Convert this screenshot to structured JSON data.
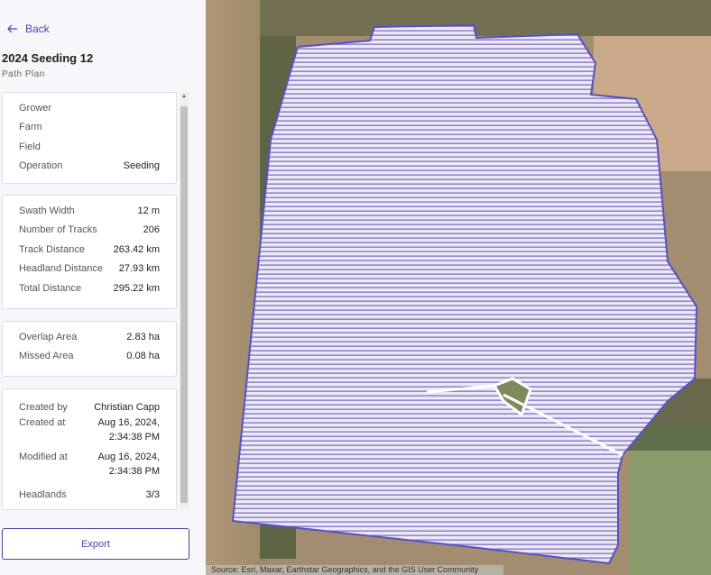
{
  "nav": {
    "back_label": "Back",
    "back_icon": "arrow-left-icon"
  },
  "header": {
    "title": "2024 Seeding 12",
    "subtitle": "Path Plan"
  },
  "cards": [
    {
      "rows": [
        {
          "label": "Grower",
          "value": ""
        },
        {
          "label": "Farm",
          "value": ""
        },
        {
          "label": "Field",
          "value": ""
        },
        {
          "label": "Operation",
          "value": "Seeding"
        }
      ]
    },
    {
      "rows": [
        {
          "label": "Swath Width",
          "value": "12 m"
        },
        {
          "label": "Number of Tracks",
          "value": "206"
        },
        {
          "label": "Track Distance",
          "value": "263.42 km"
        },
        {
          "label": "Headland Distance",
          "value": "27.93 km"
        },
        {
          "label": "Total Distance",
          "value": "295.22 km"
        }
      ]
    },
    {
      "rows": [
        {
          "label": "Overlap Area",
          "value": "2.83 ha"
        },
        {
          "label": "Missed Area",
          "value": "0.08 ha"
        }
      ]
    },
    {
      "rows": [
        {
          "label": "Created by",
          "value": "Christian Capp"
        },
        {
          "label": "Created at",
          "value": "Aug 16, 2024,\n2:34:38 PM"
        },
        {
          "label": "Modified at",
          "value": "Aug 16, 2024,\n2:34:38 PM"
        },
        {
          "label": "Headlands",
          "value": "3/3"
        }
      ]
    }
  ],
  "export_label": "Export",
  "map": {
    "attribution": "Source: Esri, Maxar, Earthstar Geographics, and the GIS User Community",
    "path_color": "#5a4fc8"
  }
}
